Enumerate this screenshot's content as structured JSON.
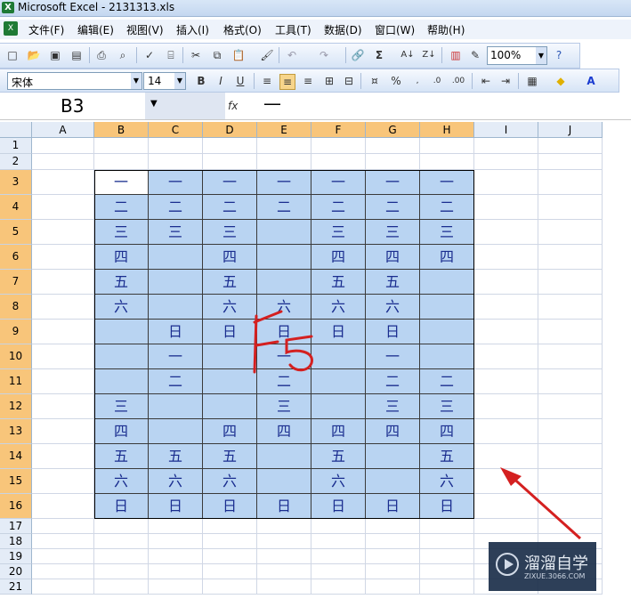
{
  "window": {
    "title": "Microsoft Excel - 2131313.xls",
    "logo": "X"
  },
  "menu": {
    "icon": "excel-doc-icon",
    "items": [
      "文件(F)",
      "编辑(E)",
      "视图(V)",
      "插入(I)",
      "格式(O)",
      "工具(T)",
      "数据(D)",
      "窗口(W)",
      "帮助(H)"
    ]
  },
  "toolbar": {
    "zoom": "100%",
    "font_name": "宋体",
    "font_size": "14",
    "bold": "B",
    "italic": "I",
    "underline": "U",
    "percent": "%"
  },
  "formula_bar": {
    "name_box": "B3",
    "fx": "fx",
    "value": "—"
  },
  "sheet": {
    "columns": [
      "A",
      "B",
      "C",
      "D",
      "E",
      "F",
      "G",
      "H",
      "I",
      "J"
    ],
    "rows": [
      "1",
      "2",
      "3",
      "4",
      "5",
      "6",
      "7",
      "8",
      "9",
      "10",
      "11",
      "12",
      "13",
      "14",
      "15",
      "16",
      "17",
      "18",
      "19",
      "20",
      "21"
    ],
    "selected_columns": [
      "B",
      "C",
      "D",
      "E",
      "F",
      "G",
      "H"
    ],
    "selected_rows": [
      "3",
      "4",
      "5",
      "6",
      "7",
      "8",
      "9",
      "10",
      "11",
      "12",
      "13",
      "14",
      "15",
      "16"
    ],
    "active_cell": "B3",
    "table": [
      [
        "一",
        "一",
        "一",
        "一",
        "一",
        "一",
        "一"
      ],
      [
        "二",
        "二",
        "二",
        "二",
        "二",
        "二",
        "二"
      ],
      [
        "三",
        "三",
        "三",
        "",
        "三",
        "三",
        "三"
      ],
      [
        "四",
        "",
        "四",
        "",
        "四",
        "四",
        "四"
      ],
      [
        "五",
        "",
        "五",
        "",
        "五",
        "五",
        ""
      ],
      [
        "六",
        "",
        "六",
        "六",
        "六",
        "六",
        ""
      ],
      [
        "",
        "日",
        "日",
        "日",
        "日",
        "日",
        ""
      ],
      [
        "",
        "一",
        "",
        "一",
        "",
        "一",
        ""
      ],
      [
        "",
        "二",
        "",
        "二",
        "",
        "二",
        "二"
      ],
      [
        "三",
        "",
        "",
        "三",
        "",
        "三",
        "三"
      ],
      [
        "四",
        "",
        "四",
        "四",
        "四",
        "四",
        "四"
      ],
      [
        "五",
        "五",
        "五",
        "",
        "五",
        "",
        "五"
      ],
      [
        "六",
        "六",
        "六",
        "",
        "六",
        "",
        "六"
      ],
      [
        "日",
        "日",
        "日",
        "日",
        "日",
        "日",
        "日"
      ]
    ]
  },
  "annotation": {
    "text": "F5",
    "color": "#d42020",
    "arrow_color": "#d42020"
  },
  "watermark": {
    "title": "溜溜自学",
    "subtitle": "ZIXUE.3066.COM"
  }
}
